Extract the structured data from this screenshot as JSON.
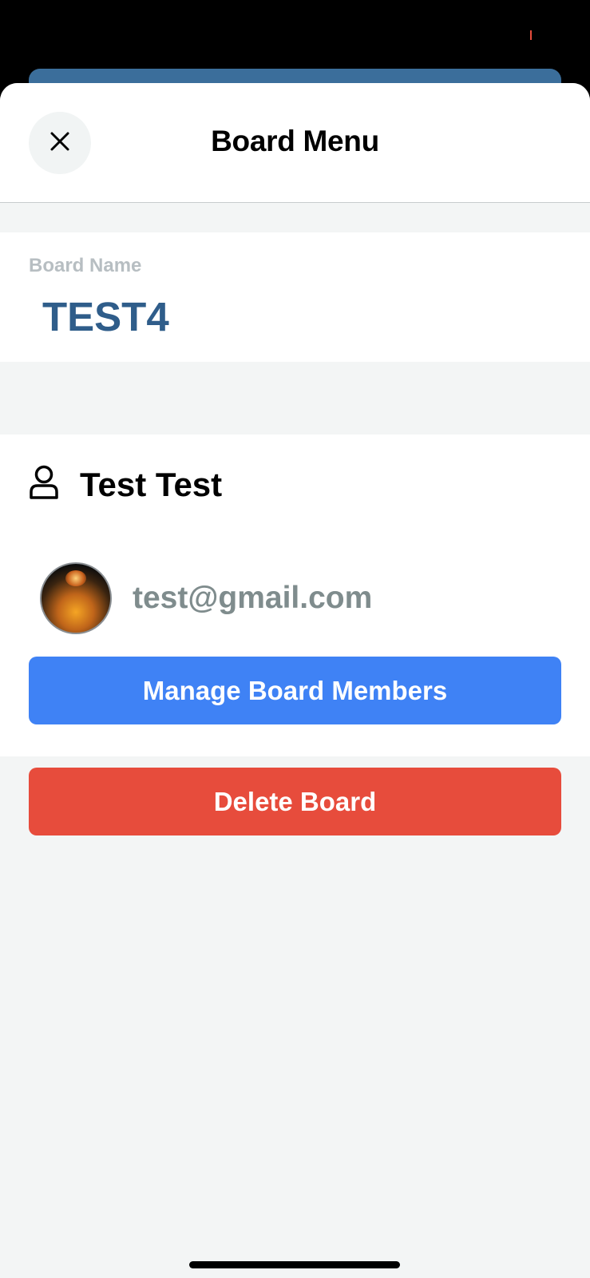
{
  "sheet": {
    "title": "Board Menu"
  },
  "board": {
    "name_label": "Board Name",
    "name": "TEST4"
  },
  "members": {
    "owner_name": "Test Test",
    "owner_icon": "user-icon",
    "list": [
      {
        "email": "test@gmail.com",
        "avatar": "planet-avatar"
      }
    ]
  },
  "actions": {
    "manage_label": "Manage Board Members",
    "delete_label": "Delete Board"
  },
  "colors": {
    "accent_blue": "#3f82f5",
    "danger_red": "#e74c3c",
    "board_name": "#2f5d8a",
    "muted_text": "#7f8c8d",
    "header_bar": "#3b6e9b"
  }
}
